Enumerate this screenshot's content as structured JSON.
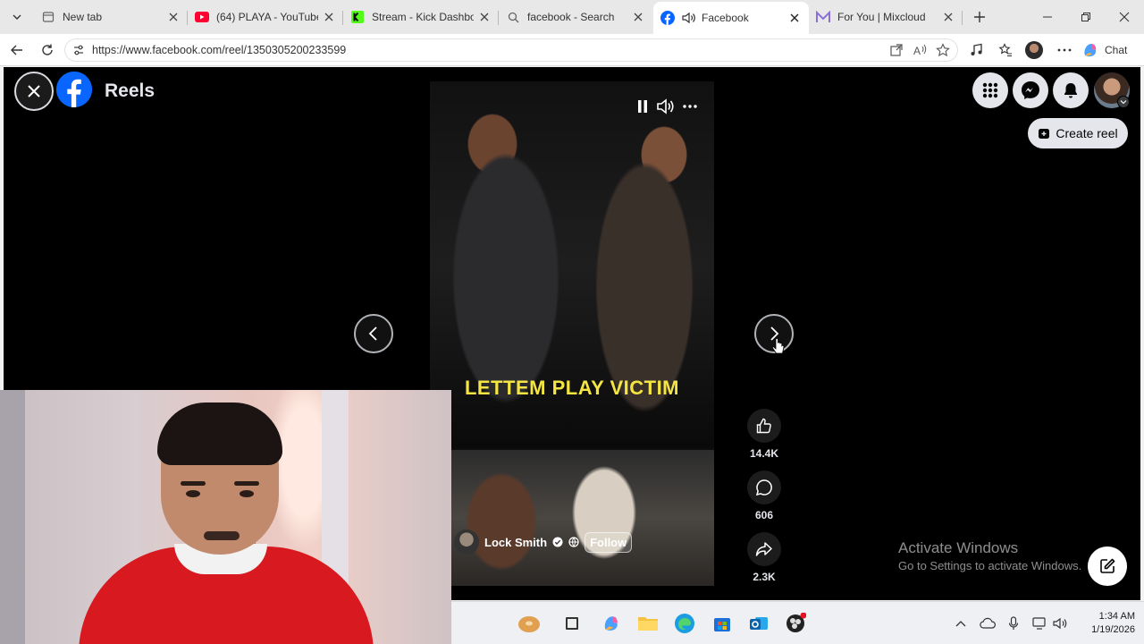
{
  "browser": {
    "tabs": [
      {
        "title": "New tab",
        "favicon": "page-icon"
      },
      {
        "title": "(64) PLAYA - YouTube",
        "favicon": "youtube-icon"
      },
      {
        "title": "Stream - Kick Dashboard",
        "favicon": "kick-icon"
      },
      {
        "title": "facebook - Search",
        "favicon": "search-icon"
      },
      {
        "title": "Facebook",
        "favicon": "facebook-icon",
        "active": true,
        "audio": true
      },
      {
        "title": "For You | Mixcloud",
        "favicon": "mixcloud-icon"
      }
    ],
    "url": "https://www.facebook.com/reel/1350305200233599",
    "chat_label": "Chat"
  },
  "page": {
    "section_title": "Reels",
    "create_reel_label": "Create reel",
    "video_caption": "LETTEM PLAY VICTIM",
    "author": {
      "name": "Lock Smith",
      "verified": true,
      "follow_label": "Follow"
    },
    "actions": [
      {
        "name": "like",
        "icon": "thumbs-up-icon",
        "count": "14.4K"
      },
      {
        "name": "comment",
        "icon": "comment-icon",
        "count": "606"
      },
      {
        "name": "share",
        "icon": "share-icon",
        "count": "2.3K"
      }
    ]
  },
  "windows_watermark": {
    "line1": "Activate Windows",
    "line2": "Go to Settings to activate Windows."
  },
  "taskbar": {
    "time": "1:34 AM",
    "date": "1/19/2026"
  },
  "colors": {
    "facebook_blue": "#0866ff",
    "caption_yellow": "#f4e542",
    "page_bg": "#000000"
  }
}
